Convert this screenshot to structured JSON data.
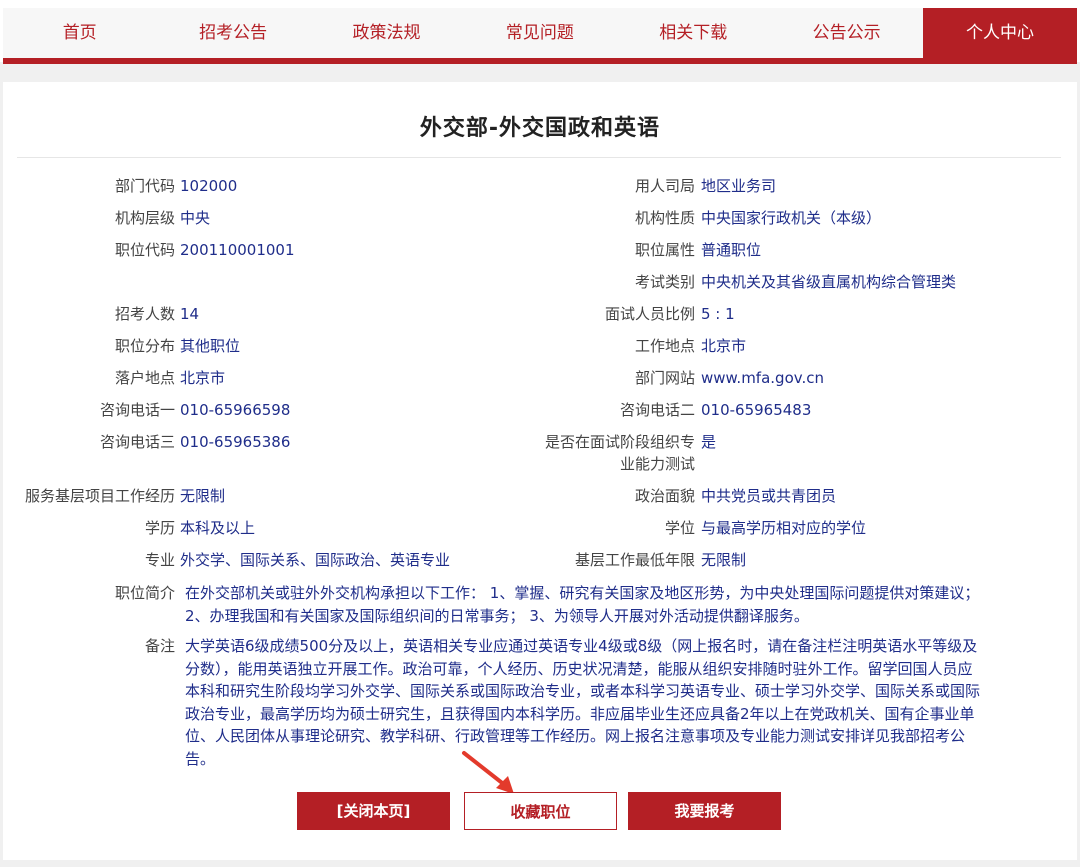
{
  "nav": {
    "items": [
      "首页",
      "招考公告",
      "政策法规",
      "常见问题",
      "相关下载",
      "公告公示",
      "个人中心"
    ]
  },
  "page": {
    "title": "外交部-外交国政和英语"
  },
  "fields": {
    "dept_code_label": "部门代码",
    "dept_code": "102000",
    "bureau_label": "用人司局",
    "bureau": "地区业务司",
    "level_label": "机构层级",
    "level": "中央",
    "nature_label": "机构性质",
    "nature": "中央国家行政机关（本级）",
    "pos_code_label": "职位代码",
    "pos_code": "200110001001",
    "pos_attr_label": "职位属性",
    "pos_attr": "普通职位",
    "exam_type_label": "考试类别",
    "exam_type": "中央机关及其省级直属机构综合管理类",
    "count_label": "招考人数",
    "count": "14",
    "ratio_label": "面试人员比例",
    "ratio": "5 : 1",
    "dist_label": "职位分布",
    "dist": "其他职位",
    "workplace_label": "工作地点",
    "workplace": "北京市",
    "hukou_label": "落户地点",
    "hukou": "北京市",
    "website_label": "部门网站",
    "website": "www.mfa.gov.cn",
    "tel1_label": "咨询电话一",
    "tel1": "010-65966598",
    "tel2_label": "咨询电话二",
    "tel2": "010-65965483",
    "tel3_label": "咨询电话三",
    "tel3": "010-65965386",
    "skilltest_label_1": "是否在面试阶段组织专",
    "skilltest_label_2": "业能力测试",
    "skilltest": "是",
    "grassroots_label": "服务基层项目工作经历",
    "grassroots": "无限制",
    "politics_label": "政治面貌",
    "politics": "中共党员或共青团员",
    "edu_label": "学历",
    "edu": "本科及以上",
    "degree_label": "学位",
    "degree": "与最高学历相对应的学位",
    "major_label": "专业",
    "major": "外交学、国际关系、国际政治、英语专业",
    "years_label": "基层工作最低年限",
    "years": "无限制"
  },
  "intro": {
    "label": "职位简介",
    "line1": "在外交部机关或驻外外交机构承担以下工作： 1、掌握、研究有关国家及地区形势，为中央处理国际问题提供对策建议；",
    "line2": "2、办理我国和有关国家及国际组织间的日常事务； 3、为领导人开展对外活动提供翻译服务。"
  },
  "remark": {
    "label": "备注",
    "line1": "大学英语6级成绩500分及以上，英语相关专业应通过英语专业4级或8级（网上报名时，请在备注栏注明英语水平等级及",
    "line2": "分数），能用英语独立开展工作。政治可靠，个人经历、历史状况清楚，能服从组织安排随时驻外工作。留学回国人员应",
    "line3": "本科和研究生阶段均学习外交学、国际关系或国际政治专业，或者本科学习英语专业、硕士学习外交学、国际关系或国际",
    "line4": "政治专业，最高学历均为硕士研究生，且获得国内本科学历。非应届毕业生还应具备2年以上在党政机关、国有企事业单",
    "line5": "位、人民团体从事理论研究、教学科研、行政管理等工作经历。网上报名注意事项及专业能力测试安排详见我部招考公",
    "line6": "告。"
  },
  "buttons": {
    "close": "[关闭本页]",
    "favorite": "收藏职位",
    "apply": "我要报考"
  },
  "colors": {
    "accent": "#b41f25",
    "value": "#1f2d8a"
  }
}
